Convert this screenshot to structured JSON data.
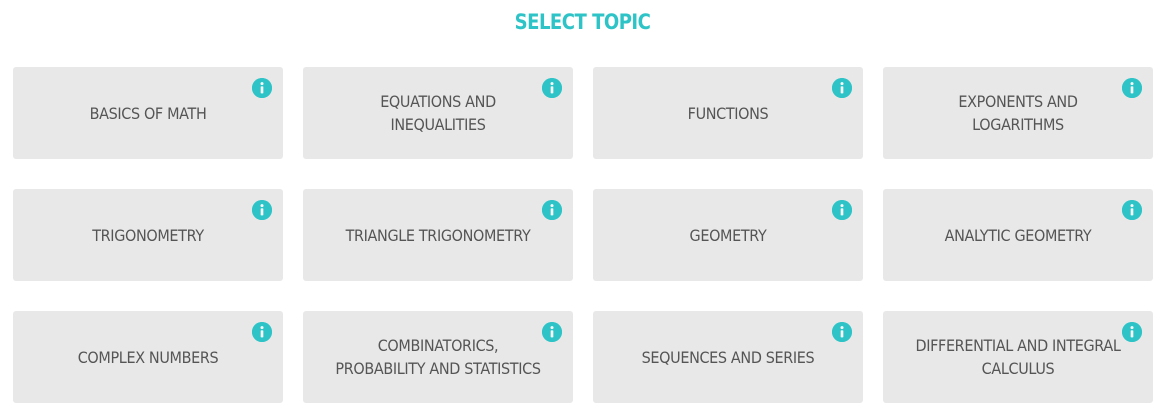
{
  "header": {
    "title": "SELECT TOPIC"
  },
  "colors": {
    "accent": "#2ec4c7",
    "card_background": "#e8e8e8",
    "card_text": "#555555"
  },
  "icons": {
    "info": "info-icon"
  },
  "topics": [
    {
      "label": "BASICS OF MATH"
    },
    {
      "label": "EQUATIONS AND INEQUALITIES"
    },
    {
      "label": "FUNCTIONS"
    },
    {
      "label": "EXPONENTS AND LOGARITHMS"
    },
    {
      "label": "TRIGONOMETRY"
    },
    {
      "label": "TRIANGLE TRIGONOMETRY"
    },
    {
      "label": "GEOMETRY"
    },
    {
      "label": "ANALYTIC GEOMETRY"
    },
    {
      "label": "COMPLEX NUMBERS"
    },
    {
      "label": "COMBINATORICS, PROBABILITY AND STATISTICS"
    },
    {
      "label": "SEQUENCES AND SERIES"
    },
    {
      "label": "DIFFERENTIAL AND INTEGRAL CALCULUS"
    }
  ]
}
